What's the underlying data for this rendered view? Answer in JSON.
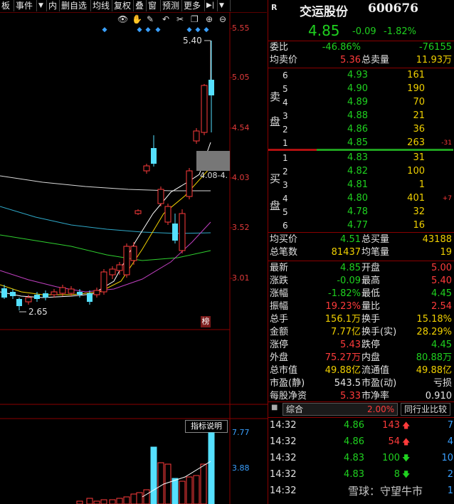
{
  "toolbar": {
    "items": [
      "板",
      "事件",
      "内",
      "删自选",
      "均线",
      "复权",
      "叠",
      "窗",
      "预测",
      "更多"
    ],
    "icons": [
      "dropdown-icon",
      "eye-icon",
      "hand-icon",
      "pencil-icon",
      "undo-icon",
      "scissors-icon",
      "copy-icon",
      "zoom-in-icon",
      "zoom-out-icon"
    ]
  },
  "chart": {
    "price_axis": [
      "5.55",
      "5.05",
      "4.54",
      "4.03",
      "3.52",
      "3.01"
    ],
    "high_label": "5.40",
    "low_label": "2.65",
    "gap_label": "4.08-4.",
    "bang_tag": "榜",
    "volume_btn": "指标说明",
    "volume_axis": [
      "7.77",
      "3.88"
    ]
  },
  "header": {
    "r_tag": "R",
    "name": "交运股份",
    "code": "600676",
    "price": "4.85",
    "change": "-0.09",
    "pct": "-1.82%"
  },
  "weibi": {
    "label": "委比",
    "pct": "-46.86%",
    "diff": "-76155"
  },
  "sell_summary": {
    "avg_label": "均卖价",
    "avg": "5.36",
    "total_label": "总卖量",
    "total": "11.93万"
  },
  "sell_side_label": [
    "卖",
    "盘"
  ],
  "sell_book": [
    {
      "n": "6",
      "p": "4.93",
      "v": "161",
      "c": ""
    },
    {
      "n": "5",
      "p": "4.90",
      "v": "190",
      "c": ""
    },
    {
      "n": "4",
      "p": "4.89",
      "v": "70",
      "c": ""
    },
    {
      "n": "3",
      "p": "4.88",
      "v": "21",
      "c": ""
    },
    {
      "n": "2",
      "p": "4.86",
      "v": "36",
      "c": ""
    },
    {
      "n": "1",
      "p": "4.85",
      "v": "263",
      "c": "-31"
    }
  ],
  "buy_side_label": [
    "买",
    "盘"
  ],
  "buy_book": [
    {
      "n": "1",
      "p": "4.83",
      "v": "31",
      "c": ""
    },
    {
      "n": "2",
      "p": "4.82",
      "v": "100",
      "c": ""
    },
    {
      "n": "3",
      "p": "4.81",
      "v": "1",
      "c": ""
    },
    {
      "n": "4",
      "p": "4.80",
      "v": "401",
      "c": "+7"
    },
    {
      "n": "5",
      "p": "4.78",
      "v": "32",
      "c": ""
    },
    {
      "n": "6",
      "p": "4.77",
      "v": "16",
      "c": ""
    }
  ],
  "buy_summary": {
    "avg_label": "均买价",
    "avg": "4.51",
    "total_label": "总买量",
    "total": "43188"
  },
  "deals": {
    "count_label": "总笔数",
    "count": "81437",
    "avg_label": "均笔量",
    "avg": "19"
  },
  "stats": [
    {
      "l1": "最新",
      "v1": "4.85",
      "c1": "green",
      "l2": "开盘",
      "v2": "5.00",
      "c2": "red"
    },
    {
      "l1": "涨跌",
      "v1": "-0.09",
      "c1": "green",
      "l2": "最高",
      "v2": "5.40",
      "c2": "red"
    },
    {
      "l1": "涨幅",
      "v1": "-1.82%",
      "c1": "green",
      "l2": "最低",
      "v2": "4.45",
      "c2": "green"
    },
    {
      "l1": "振幅",
      "v1": "19.23%",
      "c1": "red",
      "l2": "量比",
      "v2": "2.54",
      "c2": "red"
    },
    {
      "l1": "总手",
      "v1": "156.1万",
      "c1": "yellow",
      "l2": "换手",
      "v2": "15.18%",
      "c2": "yellow"
    },
    {
      "l1": "金额",
      "v1": "7.77亿",
      "c1": "yellow",
      "l2": "换手(实)",
      "v2": "28.29%",
      "c2": "yellow"
    },
    {
      "l1": "涨停",
      "v1": "5.43",
      "c1": "red",
      "l2": "跌停",
      "v2": "4.45",
      "c2": "green"
    },
    {
      "l1": "外盘",
      "v1": "75.27万",
      "c1": "red",
      "l2": "内盘",
      "v2": "80.88万",
      "c2": "green"
    },
    {
      "l1": "总市值",
      "v1": "49.88亿",
      "c1": "yellow",
      "l2": "流通值",
      "v2": "49.88亿",
      "c2": "yellow"
    },
    {
      "l1": "市盈(静)",
      "v1": "543.5",
      "c1": "white",
      "l2": "市盈(动)",
      "v2": "亏损",
      "c2": "white"
    },
    {
      "l1": "每股净资",
      "v1": "5.33",
      "c1": "red",
      "l2": "市净率",
      "v2": "0.910",
      "c2": "white"
    }
  ],
  "tabs": {
    "composite": "综合",
    "composite_pct": "2.00%",
    "industry": "同行业比较"
  },
  "ticks": [
    {
      "t": "14:32",
      "p": "4.86",
      "v": "143",
      "dir": "up",
      "k": "7"
    },
    {
      "t": "14:32",
      "p": "4.86",
      "v": "54",
      "dir": "up",
      "k": "4"
    },
    {
      "t": "14:32",
      "p": "4.83",
      "v": "100",
      "dir": "down",
      "k": "10"
    },
    {
      "t": "14:32",
      "p": "4.83",
      "v": "8",
      "dir": "down",
      "k": "2"
    },
    {
      "t": "14:32",
      "p": "",
      "v": "",
      "dir": "",
      "k": "1"
    }
  ],
  "watermark": "雪球：守望牛市",
  "colors": {
    "up": "#ff3b3b",
    "down": "#1fd11f",
    "accent_cyan": "#55e0ff",
    "axis_red": "#e23b3b",
    "volume_yellow": "#f0d000"
  }
}
